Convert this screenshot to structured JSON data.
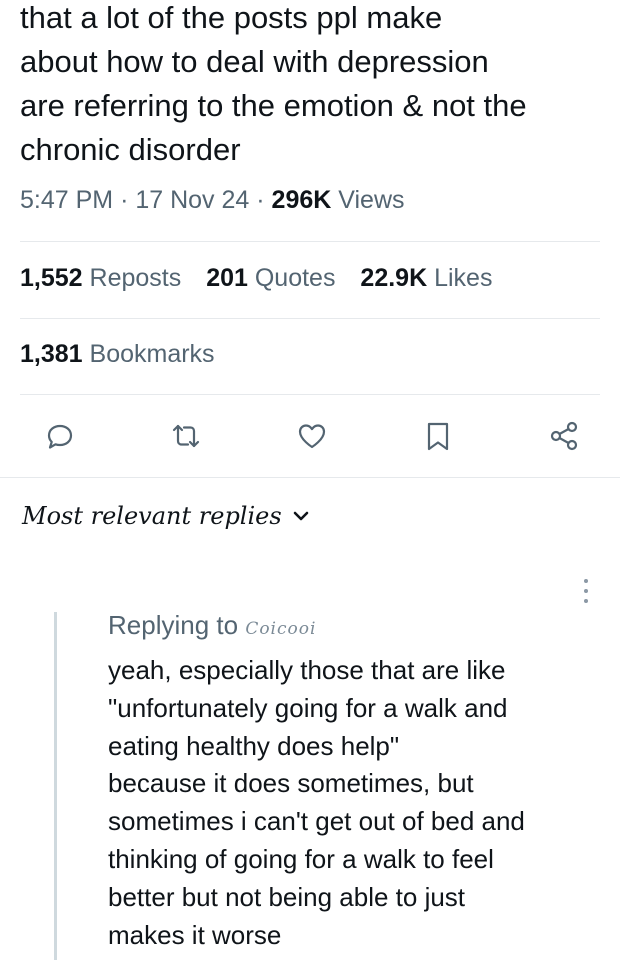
{
  "tweet": {
    "text": "that a lot of the posts ppl make\nabout how to deal with depression\nare referring to the emotion & not the\nchronic disorder",
    "time": "5:47 PM",
    "separator": "·",
    "date": "17 Nov 24",
    "views_count": "296K",
    "views_label": "Views"
  },
  "stats": {
    "reposts_count": "1,552",
    "reposts_label": "Reposts",
    "quotes_count": "201",
    "quotes_label": "Quotes",
    "likes_count": "22.9K",
    "likes_label": "Likes",
    "bookmarks_count": "1,381",
    "bookmarks_label": "Bookmarks"
  },
  "actions": {
    "icons": [
      "reply-icon",
      "repost-icon",
      "like-icon",
      "bookmark-icon",
      "share-icon"
    ]
  },
  "replies_sort": {
    "label": "Most relevant replies",
    "icon": "chevron-down-icon"
  },
  "reply": {
    "replying_prefix": "Replying to",
    "replying_handle": "Coicooi",
    "lines": [
      "yeah, especially those that are like",
      "\"unfortunately going for a walk and",
      "eating healthy does help\"",
      "because it does sometimes, but",
      "sometimes i can't get out of bed and",
      "thinking of going for a walk to feel",
      "better but not being able to just",
      "makes it worse"
    ]
  },
  "colors": {
    "text": "#0f1419",
    "secondary": "#536471",
    "divider": "#e6e9ec",
    "thread_line": "#cfd9de"
  }
}
